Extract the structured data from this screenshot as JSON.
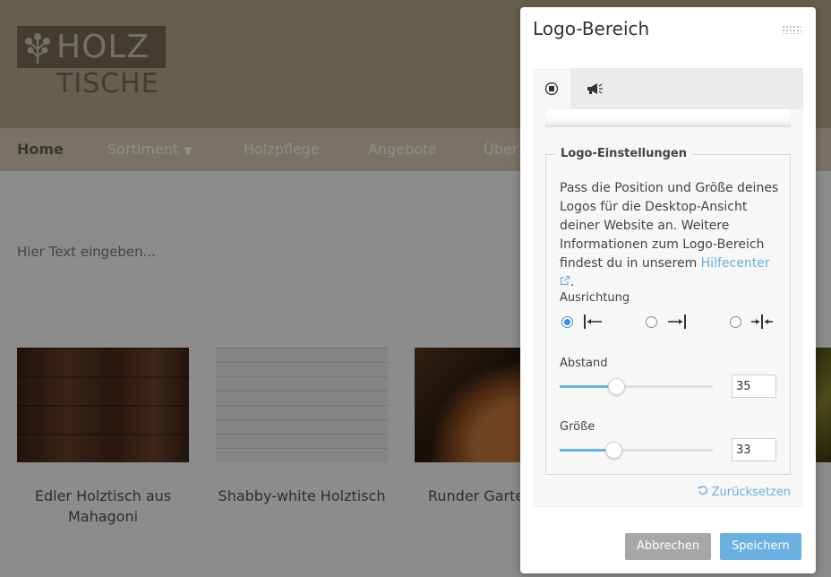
{
  "site": {
    "logo": {
      "line1": "HOLZ",
      "line2": "TISCHE"
    },
    "nav": [
      {
        "label": "Home",
        "active": true
      },
      {
        "label": "Sortiment",
        "has_dropdown": true
      },
      {
        "label": "Holzpflege"
      },
      {
        "label": "Angebote"
      },
      {
        "label": "Über"
      }
    ],
    "text_placeholder": "Hier Text eingeben...",
    "products": [
      {
        "title": "Edler Holztisch aus Mahagoni"
      },
      {
        "title": "Shabby-white Holztisch"
      },
      {
        "title": "Runder Garte"
      }
    ]
  },
  "dialog": {
    "title": "Logo-Bereich",
    "tabs": [
      {
        "icon": "layout-icon",
        "active": true
      },
      {
        "icon": "megaphone-icon",
        "active": false
      }
    ],
    "section_title": "Logo-Einstellungen",
    "description": "Pass die Position und Größe deines Logos für die Desktop-Ansicht deiner Website an. Weitere Informationen zum Logo-Bereich findest du in unserem ",
    "help_link": "Hilfecenter",
    "description_end": ".",
    "alignment": {
      "label": "Ausrichtung",
      "options": [
        {
          "icon": "align-left-icon",
          "selected": true
        },
        {
          "icon": "align-right-icon",
          "selected": false
        },
        {
          "icon": "align-center-icon",
          "selected": false
        }
      ]
    },
    "spacing": {
      "label": "Abstand",
      "value": "35",
      "slider_fraction": 0.37
    },
    "size": {
      "label": "Größe",
      "value": "33",
      "slider_fraction": 0.35
    },
    "reset_label": "Zurücksetzen",
    "cancel_label": "Abbrechen",
    "save_label": "Speichern"
  },
  "colors": {
    "accent": "#6ab0e0",
    "header_bg": "#bcad8c",
    "nav_bg": "#ddd2bb",
    "cancel_bg": "#a7a7a7"
  }
}
